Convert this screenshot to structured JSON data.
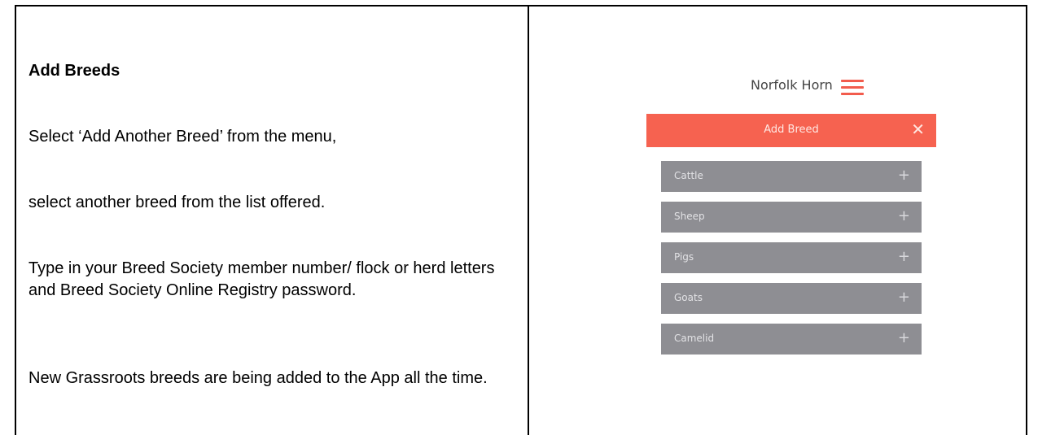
{
  "instructions": {
    "heading": "Add Breeds",
    "paragraphs": [
      "Select ‘Add Another Breed’ from the menu,",
      "select another breed from the list offered.",
      "Type in your Breed Society member number/ flock or herd letters and Breed Society Online Registry password.",
      "New Grassroots breeds are being added to the App all the time."
    ]
  },
  "app_screenshot": {
    "title": "Norfolk Horn",
    "menu_icon": "hamburger-icon",
    "add_breed_bar": {
      "label": "Add Breed",
      "close_glyph": "✕",
      "close_icon": "close-icon"
    },
    "breeds": [
      {
        "name": "Cattle",
        "action": "+"
      },
      {
        "name": "Sheep",
        "action": "+"
      },
      {
        "name": "Pigs",
        "action": "+"
      },
      {
        "name": "Goats",
        "action": "+"
      },
      {
        "name": "Camelid",
        "action": "+"
      }
    ],
    "colors": {
      "accent": "#f66250",
      "list_item": "#8e8e93"
    }
  }
}
